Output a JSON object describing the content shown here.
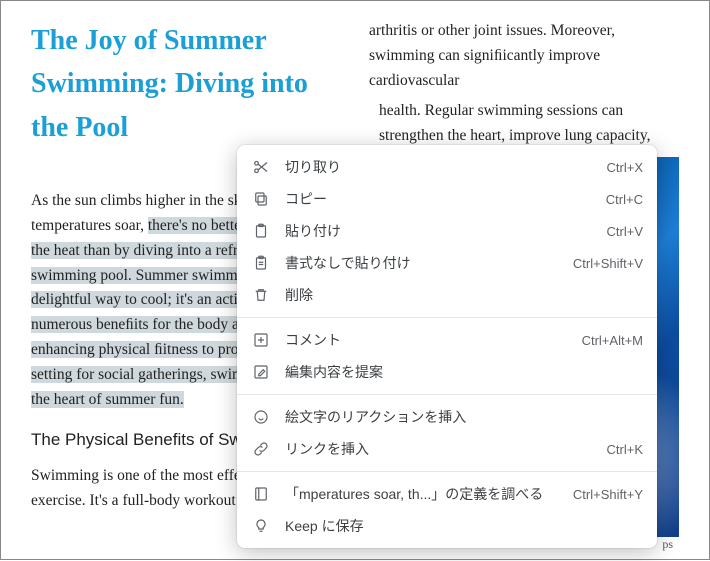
{
  "article": {
    "title": "The Joy of Summer Swimming: Diving into the Pool",
    "para1_pre": "As the sun climbs higher in the sky and temperatures soar, ",
    "para1_sel": "there's no better way to beat the heat than by diving into a refreshing swimming pool. Summer swimming is not just a delightful way to cool; it's an activity that offers numerous beneﬁits for the body and mind. From enhancing physical ﬁitness to providing a perfect setting for social gatherings, swimming pools are the heart of summer fun.",
    "subhead": "The Physical Benefits of Swimming",
    "para2": "Swimming is one of the most effective forms of exercise. It's a full-body workout that",
    "col2_top": "arthritis  or other joint issues. Moreover, swimming  can signiﬁicantly improve cardiovascular",
    "col2_indent": "health. Regular swimming sessions can strengthen the heart, improve lung capacity,",
    "caption_tail": "ps"
  },
  "menu": {
    "groups": [
      [
        {
          "id": "cut",
          "icon": "scissors",
          "label": "切り取り",
          "shortcut": "Ctrl+X"
        },
        {
          "id": "copy",
          "icon": "copy",
          "label": "コピー",
          "shortcut": "Ctrl+C"
        },
        {
          "id": "paste",
          "icon": "clipboard",
          "label": "貼り付け",
          "shortcut": "Ctrl+V"
        },
        {
          "id": "paste-plain",
          "icon": "clipboard-text",
          "label": "書式なしで貼り付け",
          "shortcut": "Ctrl+Shift+V"
        },
        {
          "id": "delete",
          "icon": "trash",
          "label": "削除",
          "shortcut": ""
        }
      ],
      [
        {
          "id": "comment",
          "icon": "plus-box",
          "label": "コメント",
          "shortcut": "Ctrl+Alt+M"
        },
        {
          "id": "suggest",
          "icon": "pencil-box",
          "label": "編集内容を提案",
          "shortcut": ""
        }
      ],
      [
        {
          "id": "emoji-react",
          "icon": "smile",
          "label": "絵文字のリアクションを挿入",
          "shortcut": ""
        },
        {
          "id": "link",
          "icon": "link",
          "label": "リンクを挿入",
          "shortcut": "Ctrl+K"
        }
      ],
      [
        {
          "id": "define",
          "icon": "dictionary",
          "label": "「mperatures soar, th...」の定義を調べる",
          "shortcut": "Ctrl+Shift+Y"
        },
        {
          "id": "keep",
          "icon": "bulb",
          "label": "Keep に保存",
          "shortcut": ""
        }
      ]
    ]
  }
}
